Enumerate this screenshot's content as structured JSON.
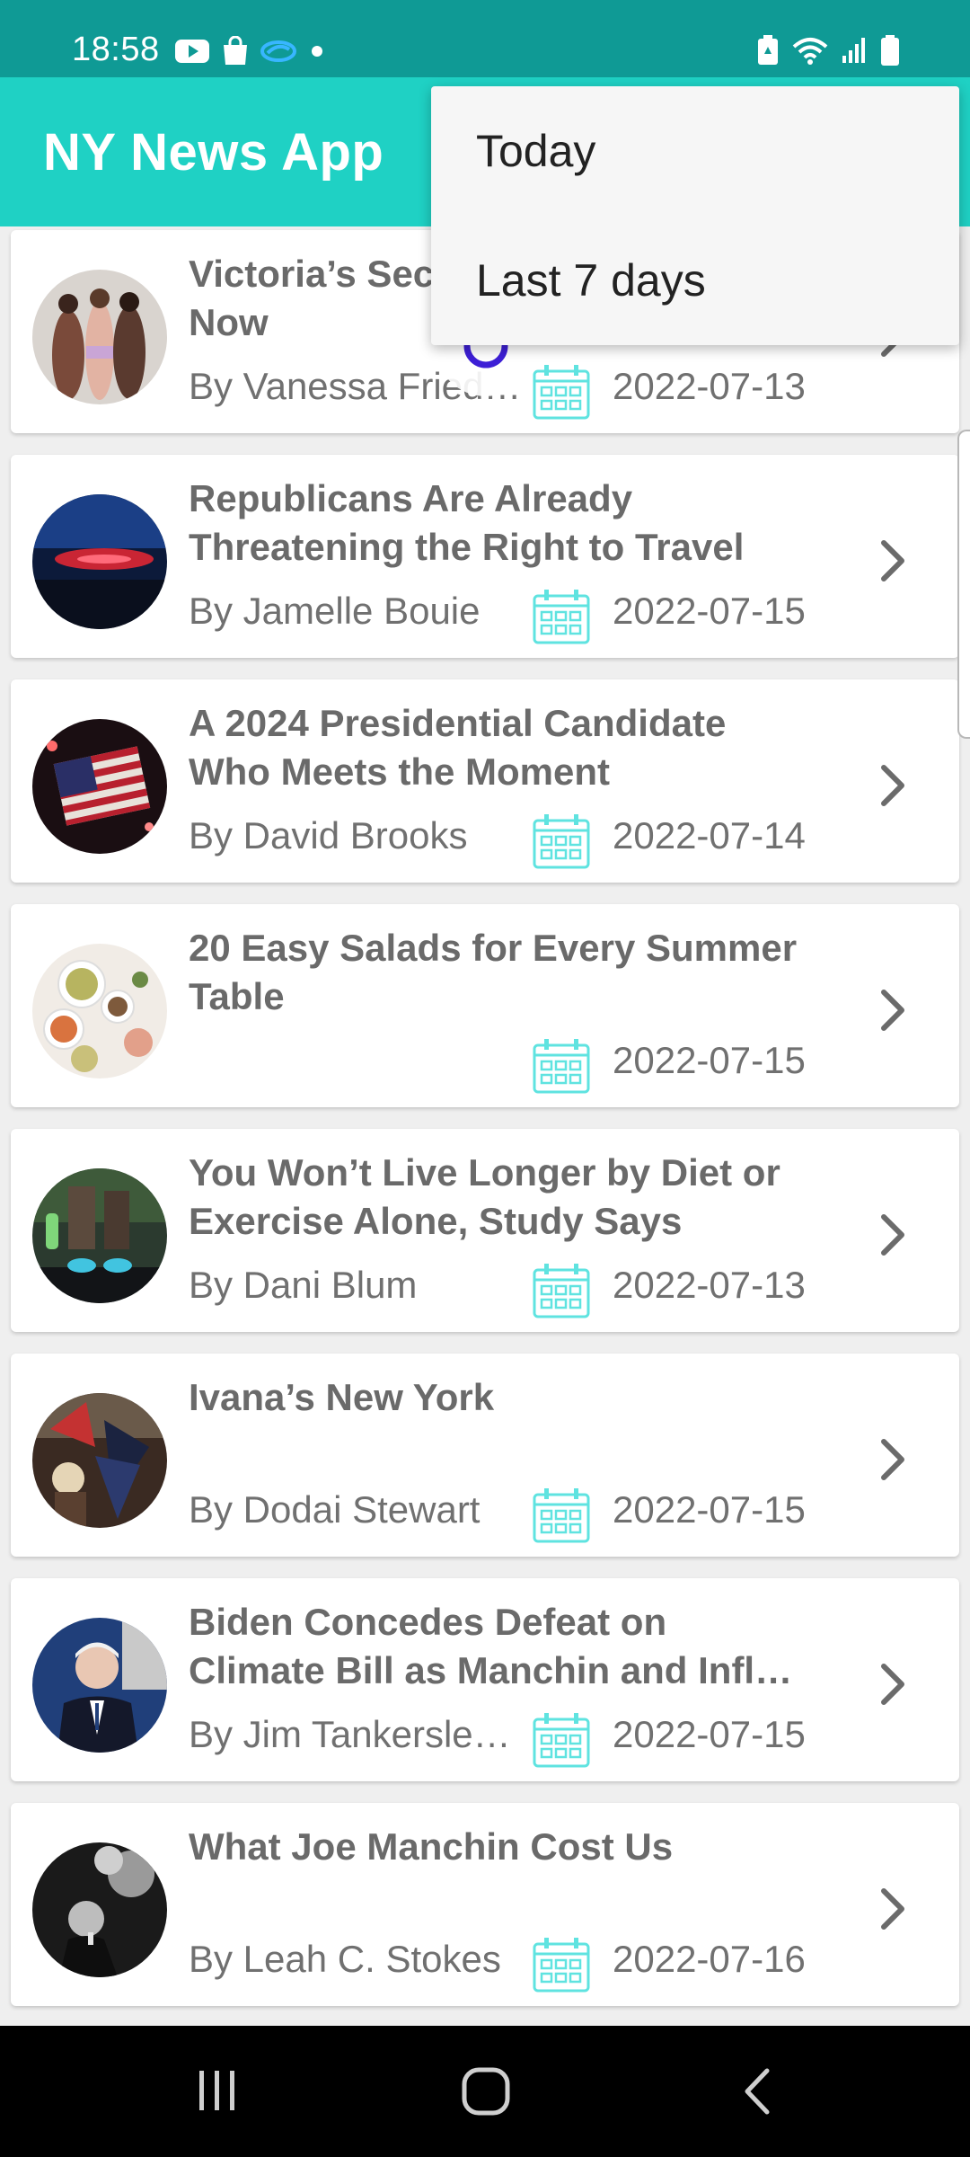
{
  "status_bar": {
    "time": "18:58",
    "left_icons": [
      "youtube-icon",
      "shopping-bag-icon",
      "cloud-sync-icon",
      "dot-icon"
    ],
    "right_icons": [
      "battery-saver-icon",
      "wifi-icon",
      "signal-icon",
      "battery-icon"
    ]
  },
  "app_bar": {
    "title": "NY News App"
  },
  "menu": {
    "items": [
      {
        "label": "Today"
      },
      {
        "label": "Last 7 days"
      }
    ]
  },
  "articles": [
    {
      "title_lines": [
        "Victoria’s Sec",
        "Now"
      ],
      "byline": "By Vanessa Fried…",
      "date": "2022-07-13"
    },
    {
      "title_lines": [
        "Republicans Are Already",
        "Threatening the Right to Travel"
      ],
      "byline": "By Jamelle Bouie",
      "date": "2022-07-15"
    },
    {
      "title_lines": [
        "A 2024 Presidential Candidate",
        "Who Meets the Moment"
      ],
      "byline": "By David Brooks",
      "date": "2022-07-14"
    },
    {
      "title_lines": [
        "20 Easy Salads for Every Summer",
        "Table"
      ],
      "byline": "",
      "date": "2022-07-15"
    },
    {
      "title_lines": [
        "You Won’t Live Longer by Diet or",
        "Exercise Alone, Study Says"
      ],
      "byline": "By Dani Blum",
      "date": "2022-07-13"
    },
    {
      "title_lines": [
        "Ivana’s New York",
        ""
      ],
      "byline": "By Dodai Stewart",
      "date": "2022-07-15"
    },
    {
      "title_lines": [
        "Biden Concedes Defeat on",
        "Climate Bill as Manchin and Infl…"
      ],
      "byline": "By Jim Tankersle…",
      "date": "2022-07-15"
    },
    {
      "title_lines": [
        "What Joe Manchin Cost Us",
        ""
      ],
      "byline": "By Leah C. Stokes",
      "date": "2022-07-16"
    }
  ],
  "colors": {
    "status_bar": "#0f9a95",
    "app_bar": "#1fd1c4",
    "calendar_icon": "#5fe3e0",
    "title_text": "#6a6a6a",
    "spinner": "#3d1fd6"
  },
  "nav_bar": {
    "buttons": [
      "recents-icon",
      "home-icon",
      "back-icon"
    ]
  }
}
